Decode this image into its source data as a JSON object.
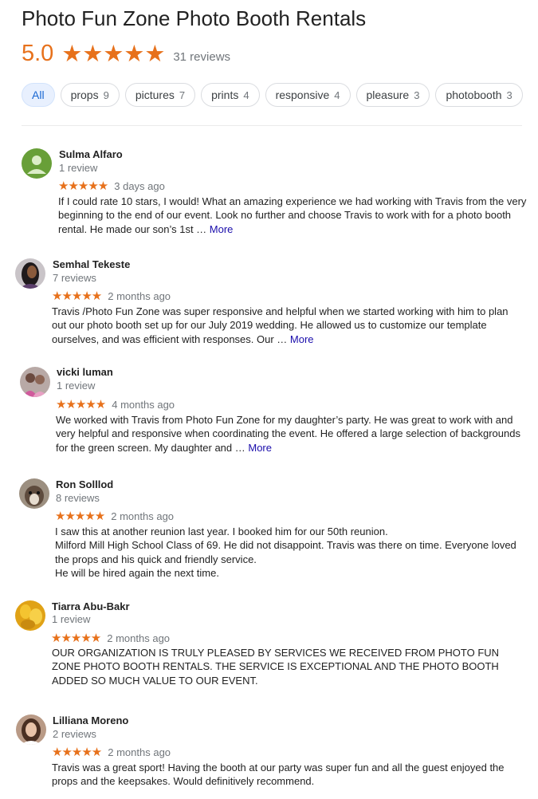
{
  "business": {
    "title": "Photo Fun Zone Photo Booth Rentals",
    "rating": "5.0",
    "stars": "★★★★★",
    "reviews_count": "31 reviews"
  },
  "filters": [
    {
      "label": "All",
      "count": ""
    },
    {
      "label": "props",
      "count": "9"
    },
    {
      "label": "pictures",
      "count": "7"
    },
    {
      "label": "prints",
      "count": "4"
    },
    {
      "label": "responsive",
      "count": "4"
    },
    {
      "label": "pleasure",
      "count": "3"
    },
    {
      "label": "photobooth",
      "count": "3"
    }
  ],
  "reviews": [
    {
      "name": "Sulma Alfaro",
      "meta": "1 review",
      "stars": "★★★★★",
      "date": "3 days ago",
      "text": "If I could rate 10 stars, I would! What an amazing experience we had working with Travis from the very beginning to the end of our event. Look no further and choose Travis to work with for a photo booth rental. He made our son’s 1st … ",
      "more": "More"
    },
    {
      "name": "Semhal Tekeste",
      "meta": "7 reviews",
      "stars": "★★★★★",
      "date": "2 months ago",
      "text": "Travis /Photo Fun Zone was super responsive and helpful when we started working with him to plan out our photo booth set up for our July 2019 wedding. He allowed us to customize our template ourselves, and was efficient with responses. Our … ",
      "more": "More"
    },
    {
      "name": "vicki luman",
      "meta": "1 review",
      "stars": "★★★★★",
      "date": "4 months ago",
      "text": "We worked with Travis from Photo Fun Zone  for my daughter’s party. He was great to work with and very helpful and responsive when coordinating the event. He offered a large selection of backgrounds for the green screen. My daughter and … ",
      "more": "More"
    },
    {
      "name": "Ron Solllod",
      "meta": "8 reviews",
      "stars": "★★★★★",
      "date": "2 months ago",
      "text": "I saw this at another reunion last year. I booked him for our 50th reunion.\nMilford Mill High School Class of 69. He did not disappoint.  Travis was there on time. Everyone loved the props and his quick and friendly service.\nHe will be hired again the next time.",
      "more": ""
    },
    {
      "name": "Tiarra Abu-Bakr",
      "meta": "1 review",
      "stars": "★★★★★",
      "date": "2 months ago",
      "text": "OUR ORGANIZATION IS TRULY PLEASED BY SERVICES WE RECEIVED FROM PHOTO FUN ZONE PHOTO BOOTH RENTALS. THE SERVICE IS EXCEPTIONAL AND THE PHOTO BOOTH ADDED SO MUCH VALUE TO OUR EVENT.",
      "more": ""
    },
    {
      "name": "Lilliana Moreno",
      "meta": "2 reviews",
      "stars": "★★★★★",
      "date": "2 months ago",
      "text": "Travis was a great sport!  Having the booth at our party was super fun and all the guest enjoyed the props and the keepsakes.  Would definitively recommend.",
      "more": ""
    }
  ],
  "colors": {
    "accent_orange": "#e7711b",
    "link": "#1a0dab",
    "chip_active_bg": "#e8f0fe",
    "chip_active_text": "#1967d2"
  }
}
